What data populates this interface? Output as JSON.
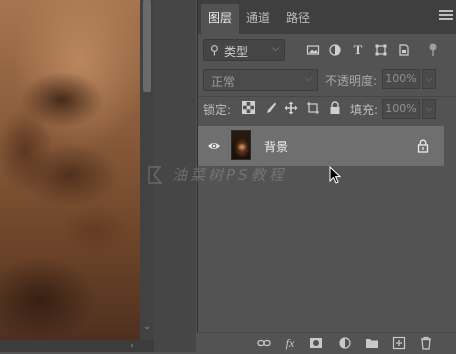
{
  "tabs": [
    {
      "label": "图层",
      "active": true
    },
    {
      "label": "通道",
      "active": false
    },
    {
      "label": "路径",
      "active": false
    }
  ],
  "panel_menu_icon": "hamburger-icon",
  "filter": {
    "label": "类型",
    "icons": [
      "image-filter-icon",
      "adjustment-filter-icon",
      "type-filter-icon",
      "shape-filter-icon",
      "smart-object-filter-icon",
      "filter-toggle-icon"
    ]
  },
  "blend": {
    "mode": "正常",
    "opacity_label": "不透明度:",
    "opacity_value": "100%"
  },
  "lock": {
    "label": "锁定:",
    "icons": [
      "lock-transparent-icon",
      "lock-pixels-icon",
      "lock-position-icon",
      "lock-artboard-icon",
      "lock-all-icon"
    ],
    "fill_label": "填充:",
    "fill_value": "100%"
  },
  "layers": [
    {
      "name": "背景",
      "visible": true,
      "locked": true
    }
  ],
  "watermark": {
    "text": "油菜树PS教程"
  },
  "bottom_icons": [
    "link-layers-icon",
    "fx-icon",
    "add-mask-icon",
    "new-adjustment-layer-icon",
    "new-group-icon",
    "new-layer-icon",
    "delete-layer-icon"
  ],
  "colors": {
    "panel_bg": "#535353",
    "tab_bar_bg": "#3f3f3f",
    "selected_layer_bg": "#6f6f6f"
  }
}
